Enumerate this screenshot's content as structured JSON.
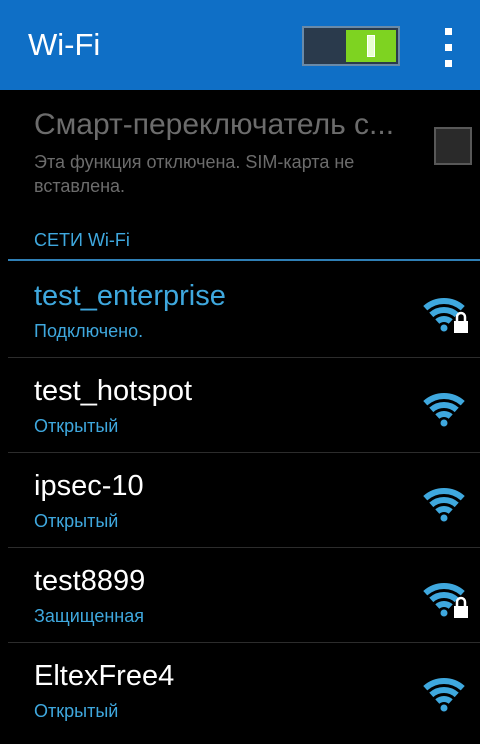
{
  "appbar": {
    "title": "Wi-Fi",
    "toggle_on": true
  },
  "smart_switch": {
    "title": "Смарт-переключатель с...",
    "description": "Эта функция отключена. SIM-карта не вставлена.",
    "checked": false
  },
  "networks_section": {
    "header": "СЕТИ Wi-Fi"
  },
  "networks": [
    {
      "ssid": "test_enterprise",
      "status": "Подключено.",
      "secured": true,
      "connected": true
    },
    {
      "ssid": "test_hotspot",
      "status": "Открытый",
      "secured": false,
      "connected": false
    },
    {
      "ssid": "ipsec-10",
      "status": "Открытый",
      "secured": false,
      "connected": false
    },
    {
      "ssid": "test8899",
      "status": "Защищенная",
      "secured": true,
      "connected": false
    },
    {
      "ssid": "EltexFree4",
      "status": "Открытый",
      "secured": false,
      "connected": false
    }
  ],
  "colors": {
    "appbar": "#0f6fc6",
    "accent": "#3fa8de",
    "toggle_on": "#7ed321",
    "background": "#000000"
  }
}
